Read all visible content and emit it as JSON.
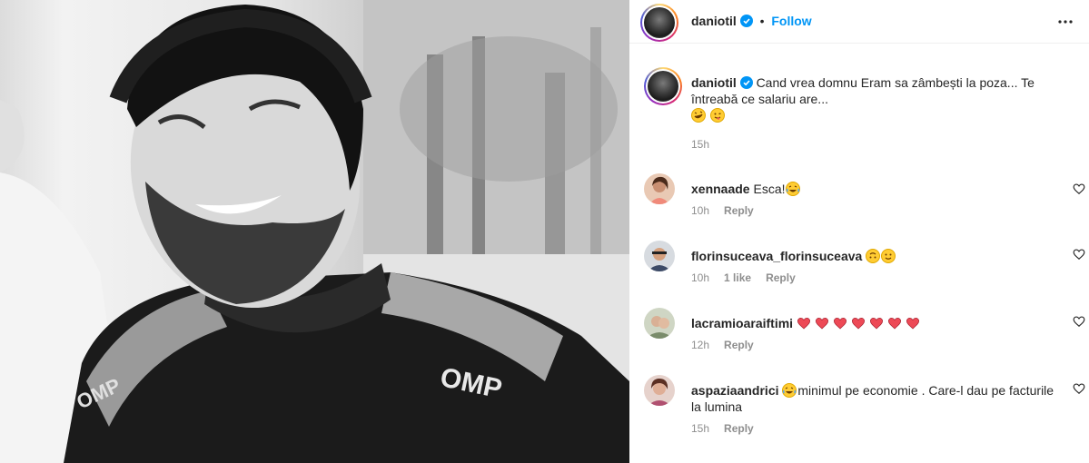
{
  "post": {
    "author": "daniotil",
    "follow_label": "Follow",
    "dot": "•"
  },
  "caption": {
    "username": "daniotil",
    "text": "Cand vrea domnu Eram sa zâmbești la poza... Te întreabă ce salariu are...",
    "emojis": [
      "rolling-laughing",
      "winking-tongue"
    ],
    "time": "15h"
  },
  "comments": [
    {
      "username": "xennaade",
      "text": "Esca!",
      "emojis_after": [
        "laughing-tears"
      ],
      "time": "10h",
      "likes": "",
      "reply_label": "Reply"
    },
    {
      "username": "florinsuceava_florinsuceava",
      "text": "",
      "emojis_after": [
        "upside-down",
        "slight-smile"
      ],
      "time": "10h",
      "likes": "1 like",
      "reply_label": "Reply"
    },
    {
      "username": "lacramioaraiftimi",
      "text": "",
      "emojis_after": [
        "heart",
        "heart",
        "heart",
        "heart",
        "heart",
        "heart",
        "heart"
      ],
      "time": "12h",
      "likes": "",
      "reply_label": "Reply"
    },
    {
      "username": "aspaziaandrici",
      "text": "minimul pe economie . Care-l dau pe facturile la lumina",
      "emojis_before": [
        "laughing-tears"
      ],
      "time": "15h",
      "likes": "",
      "reply_label": "Reply"
    }
  ],
  "colors": {
    "accent": "#0095f6",
    "muted": "#8e8e8e",
    "text": "#262626",
    "heart": "#ed4956"
  }
}
